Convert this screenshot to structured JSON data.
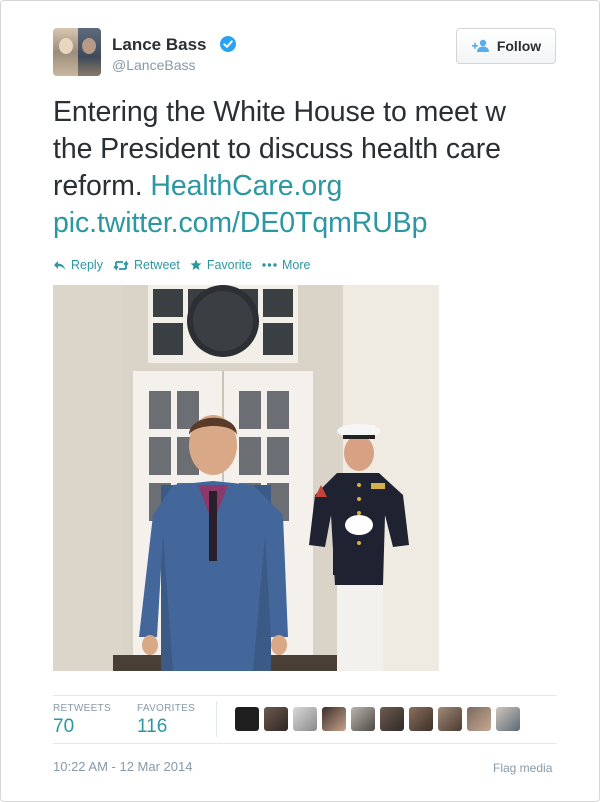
{
  "author": {
    "name": "Lance Bass",
    "handle": "@LanceBass",
    "verified": true
  },
  "follow_button": {
    "label": "Follow",
    "icon": "add-user-icon"
  },
  "tweet": {
    "lines": [
      "Entering the White House to meet w",
      "the President to discuss health care",
      "reform. "
    ],
    "link_inline": "HealthCare.org",
    "pic_link": "pic.twitter.com/DE0TqmRUBp"
  },
  "actions": [
    {
      "label": "Reply",
      "icon": "reply-icon"
    },
    {
      "label": "Retweet",
      "icon": "retweet-icon"
    },
    {
      "label": "Favorite",
      "icon": "star-icon"
    },
    {
      "label": "More",
      "icon": "more-dots-icon"
    }
  ],
  "media": {
    "description_icon": "photo"
  },
  "stats": {
    "retweets_label": "RETWEETS",
    "retweets_value": "70",
    "favorites_label": "FAVORITES",
    "favorites_value": "116"
  },
  "footer": {
    "timestamp": "10:22 AM - 12 Mar 2014",
    "flag_label": "Flag media"
  },
  "colors": {
    "link": "#2b97a3",
    "text": "#292f33",
    "muted": "#8899a6",
    "verified": "#2aa3ef"
  }
}
